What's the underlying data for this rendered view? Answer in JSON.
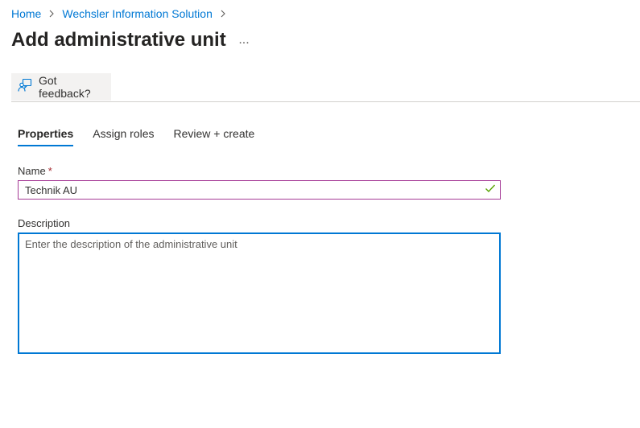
{
  "breadcrumb": {
    "items": [
      "Home",
      "Wechsler Information Solution"
    ]
  },
  "header": {
    "title": "Add administrative unit",
    "more_label": "..."
  },
  "toolbar": {
    "feedback_label": "Got feedback?"
  },
  "tabs": [
    {
      "label": "Properties",
      "active": true
    },
    {
      "label": "Assign roles",
      "active": false
    },
    {
      "label": "Review + create",
      "active": false
    }
  ],
  "form": {
    "name": {
      "label": "Name",
      "required_marker": "*",
      "value": "Technik AU",
      "valid": true
    },
    "description": {
      "label": "Description",
      "value": "",
      "placeholder": "Enter the description of the administrative unit"
    }
  },
  "colors": {
    "accent": "#0078d4",
    "name_border": "#a53b96",
    "valid_check": "#57a300",
    "required": "#a4262c"
  },
  "icons": {
    "feedback": "feedback-person-icon",
    "breadcrumb_separator": "chevron-right-icon",
    "valid": "checkmark-icon"
  }
}
